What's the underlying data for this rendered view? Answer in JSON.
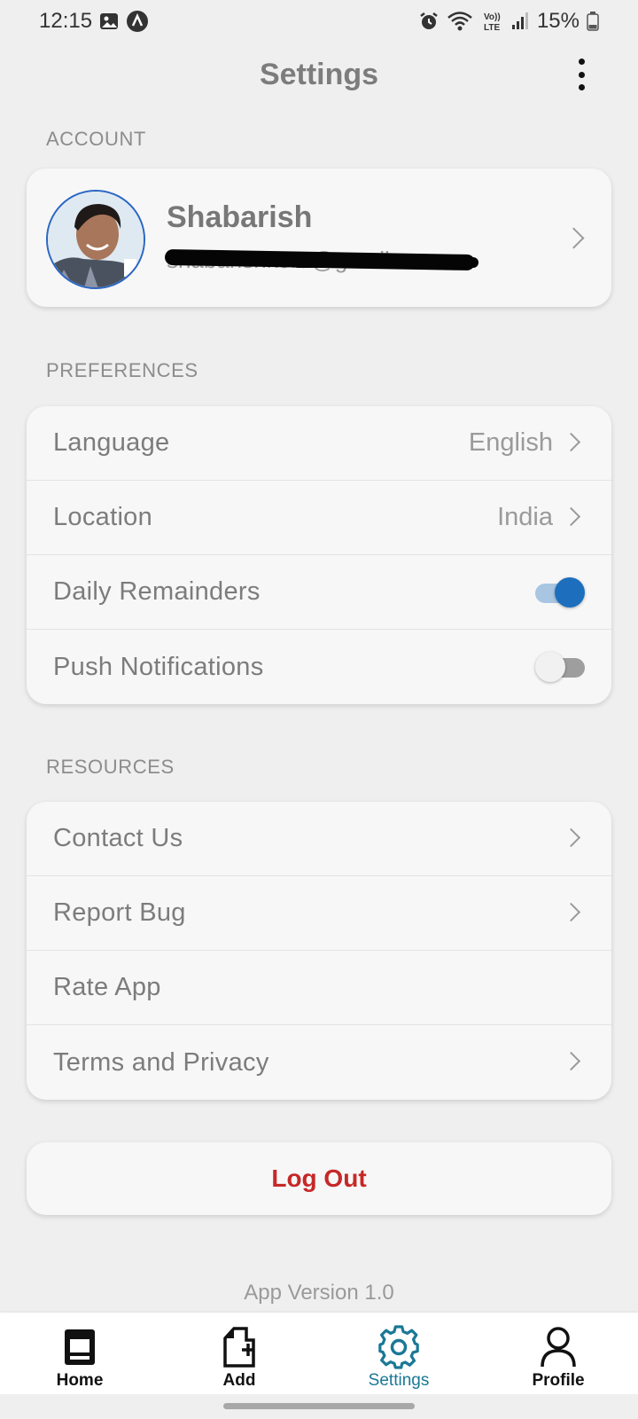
{
  "status_bar": {
    "time": "12:15",
    "battery": "15%",
    "left_icons": [
      "image-icon",
      "app-a-icon"
    ],
    "right_icons": [
      "alarm-icon",
      "wifi-icon",
      "volte-icon",
      "signal-icon",
      "battery-icon"
    ]
  },
  "header": {
    "title": "Settings",
    "menu_icon": "more-vertical-icon"
  },
  "sections": {
    "account": "ACCOUNT",
    "preferences": "PREFERENCES",
    "resources": "RESOURCES"
  },
  "account": {
    "name": "Shabarish",
    "email": "shabarishkora@gmail.com"
  },
  "preferences": {
    "language": {
      "label": "Language",
      "value": "English"
    },
    "location": {
      "label": "Location",
      "value": "India"
    },
    "daily_reminders": {
      "label": "Daily Remainders",
      "enabled": true
    },
    "push_notifications": {
      "label": "Push Notifications",
      "enabled": false
    }
  },
  "resources": {
    "contact": "Contact Us",
    "report_bug": "Report Bug",
    "rate_app": "Rate App",
    "terms": "Terms and Privacy"
  },
  "logout": "Log Out",
  "app_version": "App Version 1.0",
  "nav": {
    "home": "Home",
    "add": "Add",
    "settings": "Settings",
    "profile": "Profile",
    "active": "Settings"
  },
  "colors": {
    "accent": "#1d6fbd",
    "nav_active": "#1a7896",
    "logout": "#c62828",
    "background": "#efefef"
  }
}
